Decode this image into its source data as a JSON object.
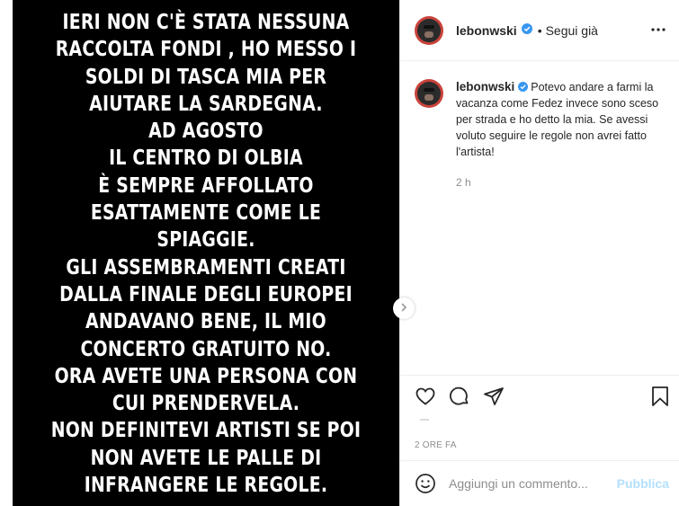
{
  "story": {
    "lines": [
      "IERI NON C'È STATA NESSUNA",
      "RACCOLTA FONDI , HO MESSO I",
      "SOLDI DI TASCA MIA PER",
      "AIUTARE LA SARDEGNA.",
      "AD AGOSTO",
      "IL CENTRO DI OLBIA",
      "È SEMPRE AFFOLLATO",
      "ESATTAMENTE COME LE",
      "SPIAGGIE.",
      "GLI ASSEMBRAMENTI CREATI",
      "DALLA FINALE DEGLI EUROPEI",
      "ANDAVANO BENE, IL MIO",
      "CONCERTO GRATUITO NO.",
      "ORA AVETE UNA PERSONA CON",
      "CUI PRENDERVELA.",
      "NON DEFINITEVI ARTISTI SE POI",
      "NON AVETE LE PALLE DI",
      "INFRANGERE LE REGOLE."
    ]
  },
  "post": {
    "username": "lebonwski",
    "separator": "•",
    "follow_status": "Segui già",
    "more_icon": "more-dots-icon",
    "verified_color": "#3897f0"
  },
  "caption": {
    "username": "lebonwski",
    "text": "Potevo andare a farmi la vacanza come Fedez invece sono sceso per strada e ho detto la mia. Se avessi voluto seguire le regole non avrei fatto l'artista!",
    "time": "2 h"
  },
  "actions": {
    "icons": [
      "heart-icon",
      "comment-icon",
      "share-icon",
      "bookmark-icon"
    ]
  },
  "meta": {
    "age": "2 ORE FA"
  },
  "add_comment": {
    "placeholder": "Aggiungi un commento...",
    "publish_label": "Pubblica",
    "publish_color": "#b2dffc"
  }
}
